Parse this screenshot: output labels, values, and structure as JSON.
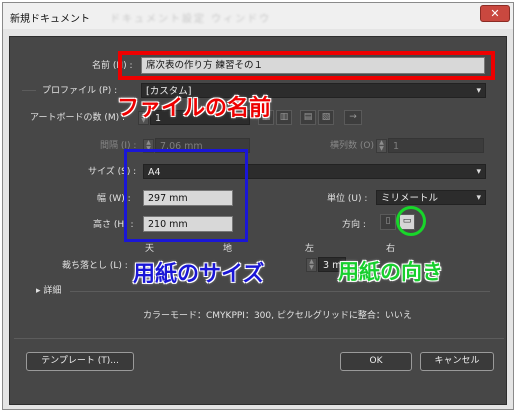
{
  "window": {
    "title": "新規ドキュメント",
    "blurred_title": "ドキュメント設定 ウィンドウ",
    "close_glyph": "✕"
  },
  "form": {
    "name": {
      "label": "名前 (N) :",
      "value": "席次表の作り方 練習その１"
    },
    "profile": {
      "label": "プロファイル (P) :",
      "value": "[カスタム]"
    },
    "artboards": {
      "label": "アートボードの数 (M) :",
      "value": "1"
    },
    "spacing": {
      "label": "間隔 (I) :",
      "value": "7.06 mm"
    },
    "columns": {
      "label": "横列数 (O) :",
      "value": "1"
    },
    "size": {
      "label": "サイズ (S) :",
      "value": "A4"
    },
    "width": {
      "label": "幅 (W) :",
      "value": "297 mm"
    },
    "height": {
      "label": "高さ (H) :",
      "value": "210 mm"
    },
    "units": {
      "label": "単位 (U) :",
      "value": "ミリメートル"
    },
    "orientation": {
      "label": "方向 :"
    },
    "bleed": {
      "label": "裁ち落とし (L) :",
      "headers": [
        "天",
        "地",
        "左",
        "右"
      ],
      "value": "3 mm"
    },
    "advanced": {
      "label": "詳細"
    },
    "summary": "カラーモード：CMYKPPI：300, ピクセルグリッドに整合：いいえ"
  },
  "buttons": {
    "templates": "テンプレート (T)...",
    "ok": "OK",
    "cancel": "キャンセル"
  },
  "annotations": {
    "file_name": "ファイルの名前",
    "paper_size": "用紙のサイズ",
    "orientation": "用紙の向き"
  },
  "colors": {
    "red": "#ee0000",
    "blue": "#1a16d6",
    "green": "#18d62a",
    "panel": "#474747"
  }
}
